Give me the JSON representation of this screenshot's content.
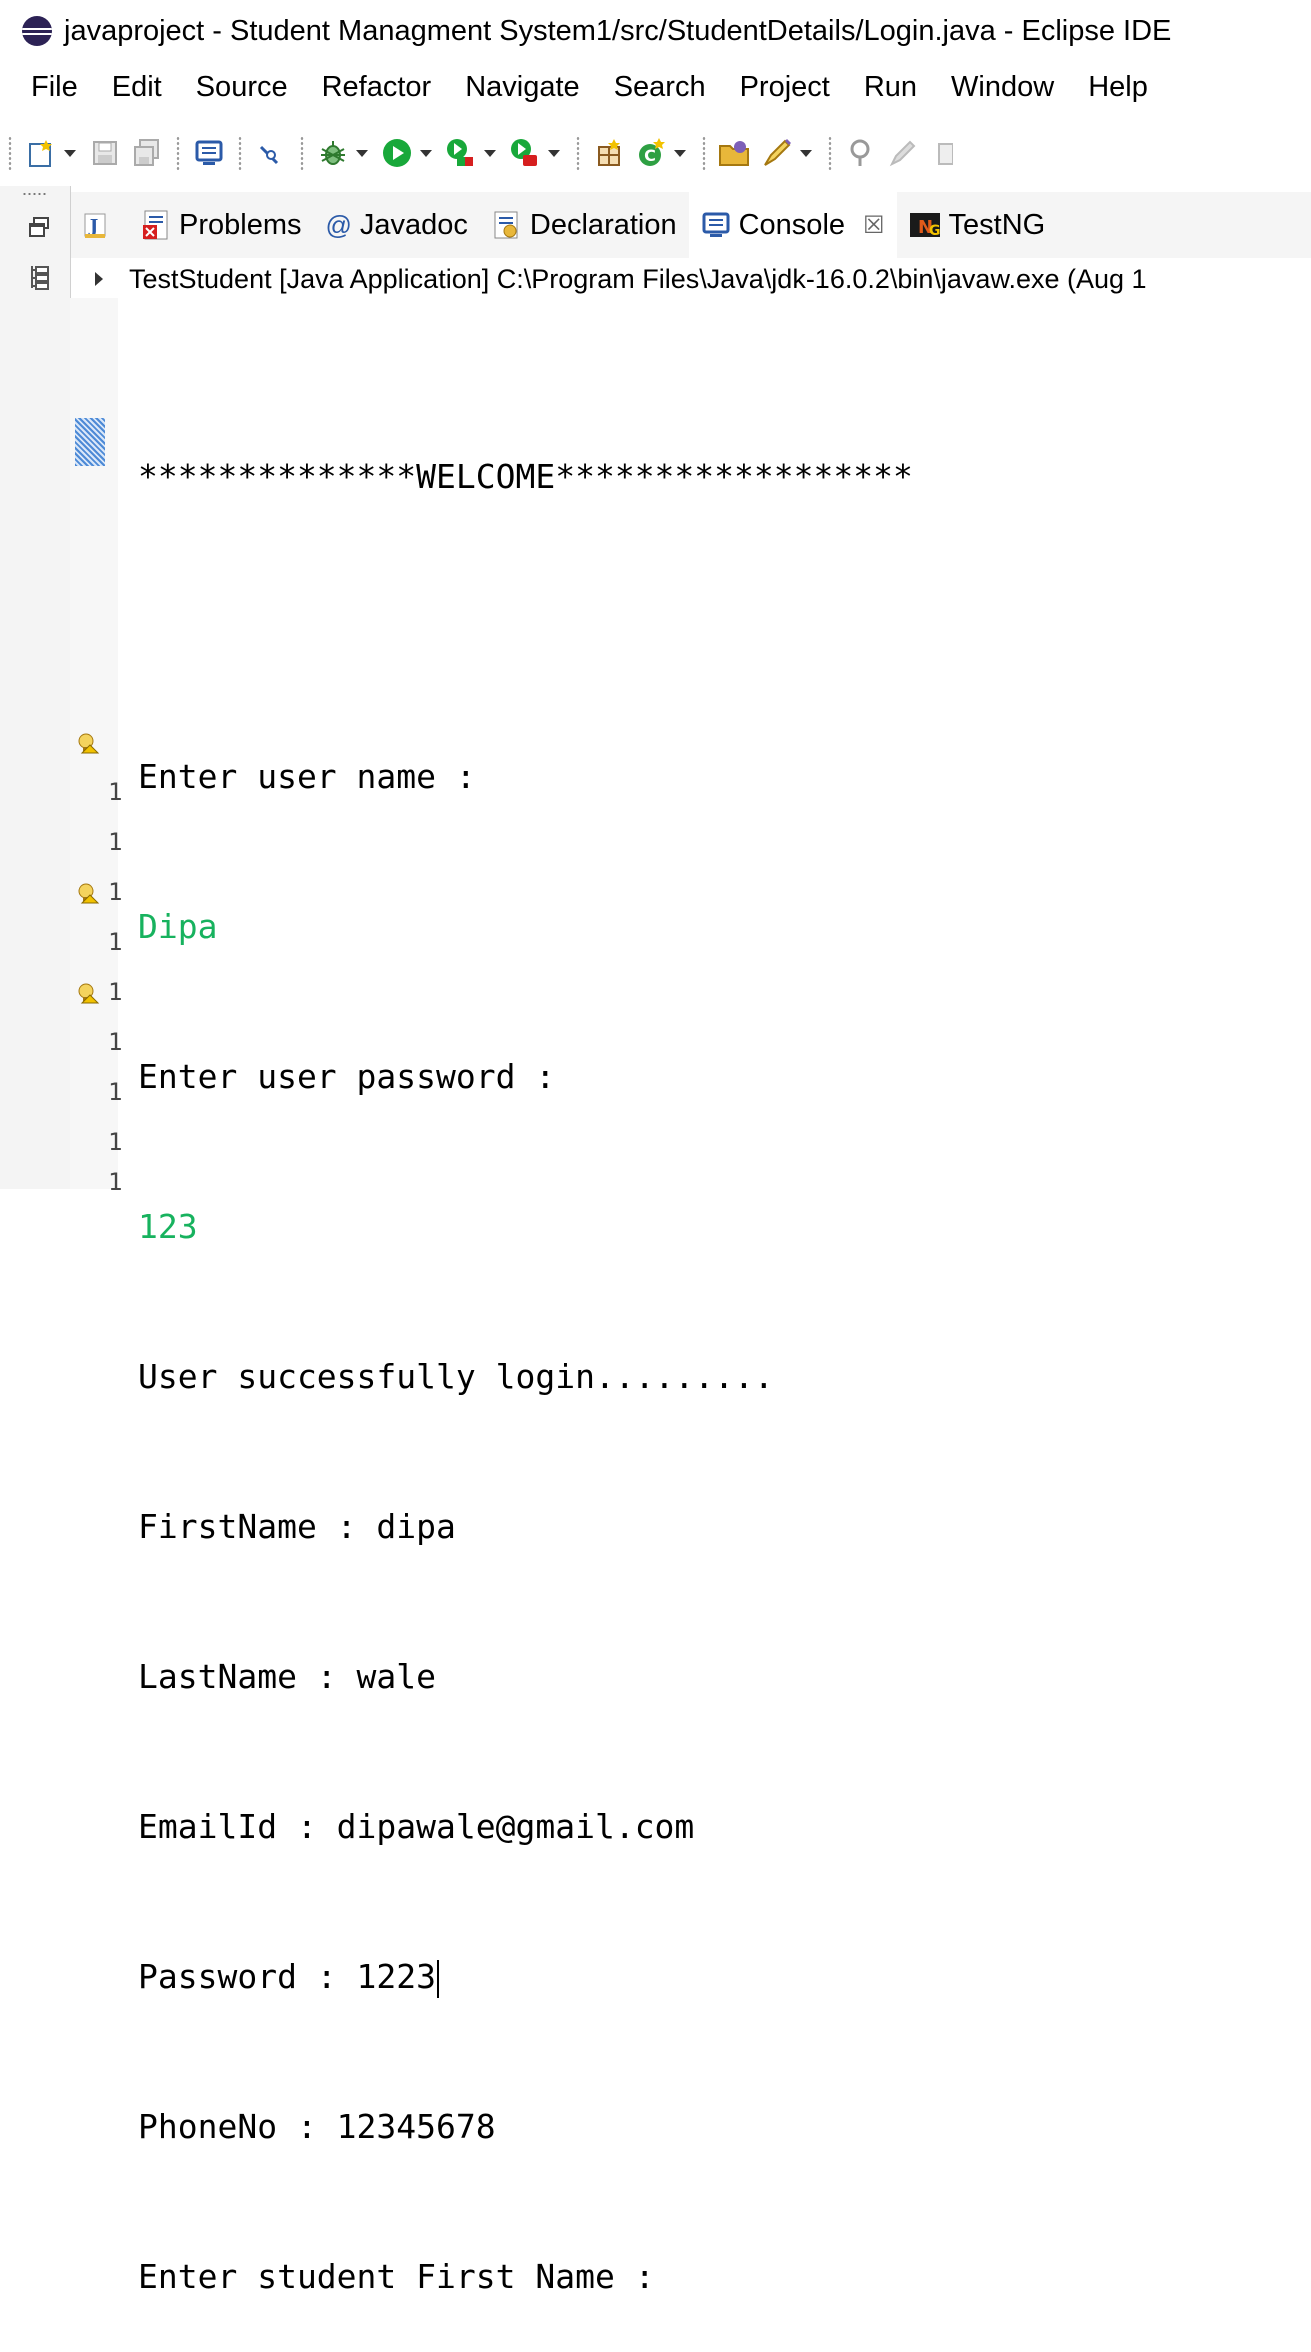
{
  "window": {
    "title": "javaproject - Student Managment System1/src/StudentDetails/Login.java - Eclipse IDE"
  },
  "menu": [
    "File",
    "Edit",
    "Source",
    "Refactor",
    "Navigate",
    "Search",
    "Project",
    "Run",
    "Window",
    "Help"
  ],
  "view_tabs": [
    {
      "label": "Problems",
      "icon": "problems-icon"
    },
    {
      "label": "Javadoc",
      "icon": "javadoc-icon",
      "prefix": "@"
    },
    {
      "label": "Declaration",
      "icon": "declaration-icon"
    },
    {
      "label": "Console",
      "icon": "console-icon",
      "active": true,
      "close": "☒"
    },
    {
      "label": "TestNG",
      "icon": "testng-icon"
    }
  ],
  "console": {
    "process": "TestStudent [Java Application] C:\\Program Files\\Java\\jdk-16.0.2\\bin\\javaw.exe  (Aug 1",
    "lines": [
      {
        "text": "**************WELCOME******************",
        "kind": "out"
      },
      {
        "text": "",
        "kind": "blank"
      },
      {
        "text": "Enter user name :",
        "kind": "out"
      },
      {
        "text": "Dipa",
        "kind": "in"
      },
      {
        "text": "Enter user password :",
        "kind": "out"
      },
      {
        "text": "123",
        "kind": "in"
      },
      {
        "text": "User successfully login.........",
        "kind": "out"
      },
      {
        "text": "FirstName : dipa",
        "kind": "out"
      },
      {
        "text": "LastName : wale",
        "kind": "out"
      },
      {
        "text": "EmailId : dipawale@gmail.com",
        "kind": "out"
      },
      {
        "text": "Password : 1223",
        "kind": "out"
      },
      {
        "text": "PhoneNo : 12345678",
        "kind": "out"
      },
      {
        "text": "Enter student First Name :",
        "kind": "out"
      }
    ]
  },
  "gutter_numbers": [
    "1",
    "1",
    "1",
    "1",
    "1",
    "1",
    "1",
    "1",
    "1"
  ],
  "colors": {
    "input_text": "#17b25e",
    "title_icon": "#2c2255"
  }
}
